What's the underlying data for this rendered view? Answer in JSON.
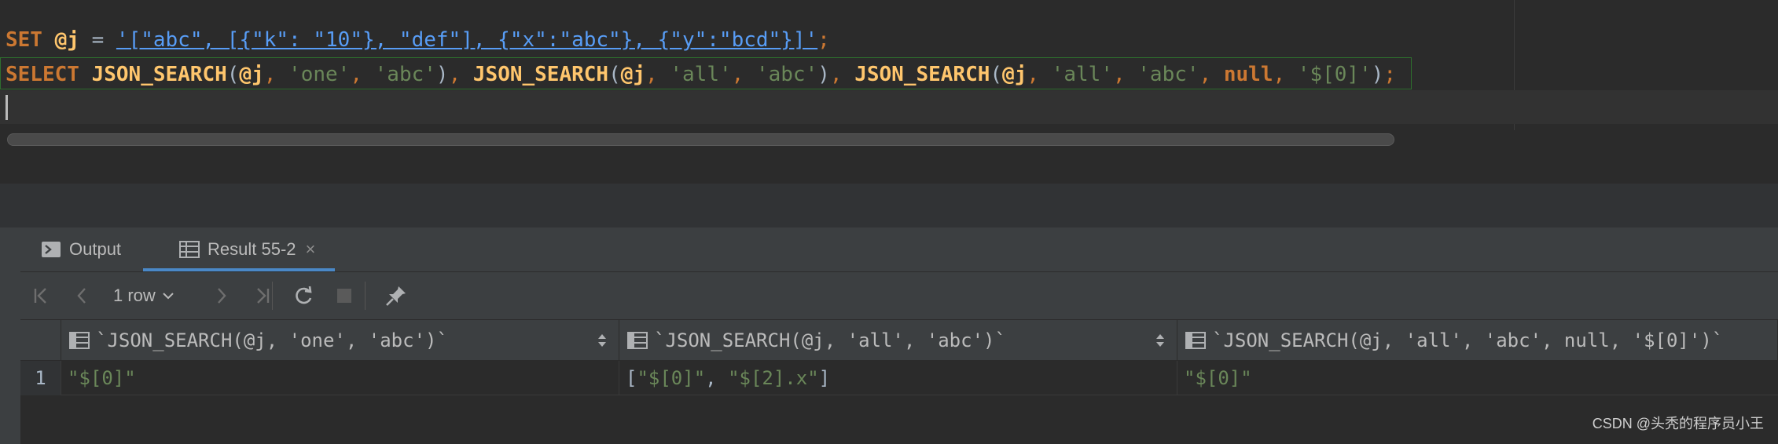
{
  "editor": {
    "line1": {
      "kw_set": "SET",
      "var": "@j",
      "eq": " = ",
      "json_literal": "'[\"abc\", [{\"k\": \"10\"}, \"def\"], {\"x\":\"abc\"}, {\"y\":\"bcd\"}]'",
      "semi": ";"
    },
    "line2": {
      "kw_select": "SELECT",
      "fn1": "JSON_SEARCH",
      "fn2": "JSON_SEARCH",
      "fn3": "JSON_SEARCH",
      "var": "@j",
      "one": "'one'",
      "all": "'all'",
      "abc": "'abc'",
      "null_kw": "null",
      "path": "'$[0]'",
      "open": "(",
      "close": ")",
      "comma": ", ",
      "semi": ";"
    }
  },
  "tabs": [
    {
      "label": "Output",
      "icon": "console-icon"
    },
    {
      "label": "Result 55-2",
      "icon": "table-icon",
      "close": "×"
    }
  ],
  "toolbar": {
    "row_count": "1 row"
  },
  "table": {
    "columns": [
      "`JSON_SEARCH(@j, 'one', 'abc')`",
      "`JSON_SEARCH(@j, 'all', 'abc')`",
      "`JSON_SEARCH(@j, 'all', 'abc', null, '$[0]')`"
    ],
    "rows": [
      {
        "num": "1",
        "c1": "\"$[0]\"",
        "c2_open": "[",
        "c2_v1": "\"$[0]\"",
        "c2_sep": ", ",
        "c2_v2": "\"$[2].x\"",
        "c2_close": "]",
        "c3": "\"$[0]\""
      }
    ]
  },
  "watermark": "CSDN @头秃的程序员小王",
  "colors": {
    "keyword": "#cc7832",
    "function": "#ffc66d",
    "string": "#6a8759",
    "link_string": "#589df6",
    "accent": "#4a88c7"
  }
}
